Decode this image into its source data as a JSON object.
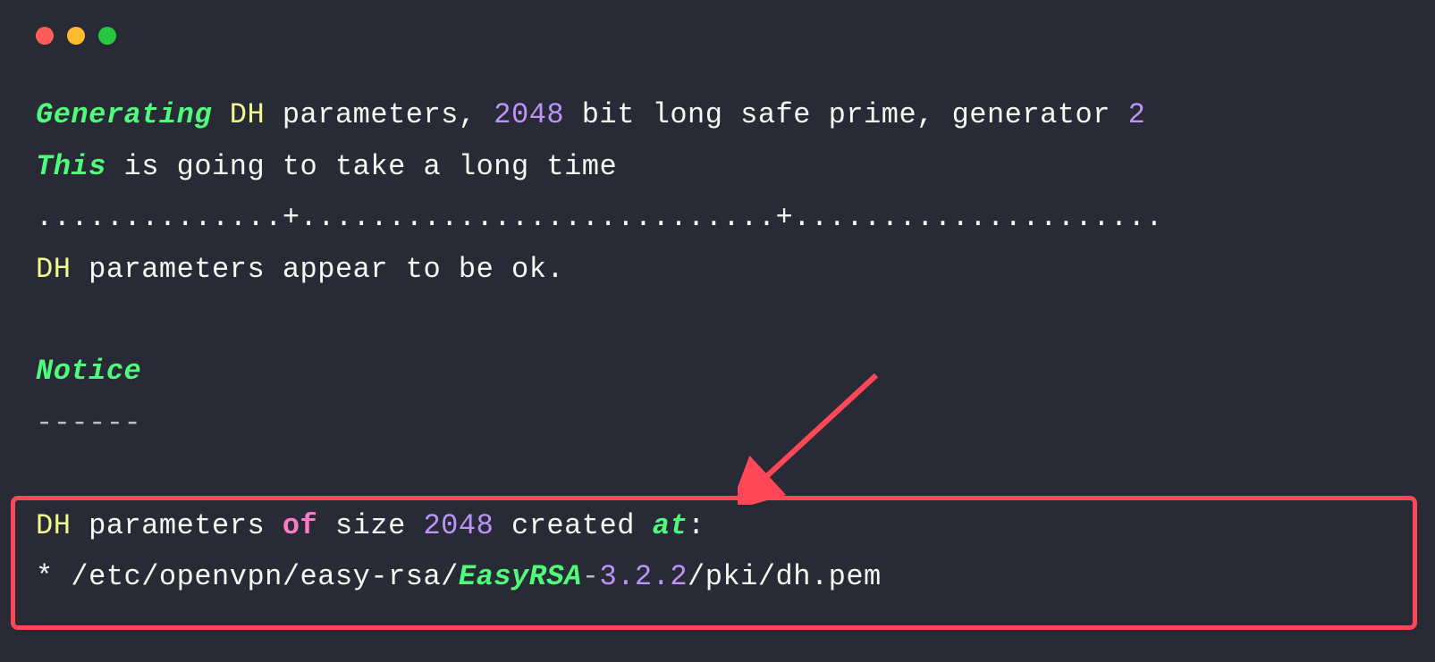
{
  "line1": {
    "generating": "Generating",
    "dh": "DH",
    "params": " parameters, ",
    "size": "2048",
    "rest": " bit long safe prime, generator ",
    "gen": "2"
  },
  "line2": {
    "this": "This",
    "rest": " is going to take a long time"
  },
  "line3": "..............+...........................+.....................",
  "line4": {
    "dh": "DH",
    "rest": " parameters appear to be ok."
  },
  "line6": "Notice",
  "line7": "------",
  "line9": {
    "dh": "DH",
    "params": " parameters ",
    "of": "of",
    "size_label": " size ",
    "size": "2048",
    "created": " created ",
    "at": "at",
    "colon": ":"
  },
  "line10": {
    "star": "* ",
    "path1": "/etc/openvpn/easy-rsa/",
    "easyrsa": "EasyRSA",
    "dash": "-",
    "version": "3.2.2",
    "path2": "/pki/dh.pem"
  }
}
